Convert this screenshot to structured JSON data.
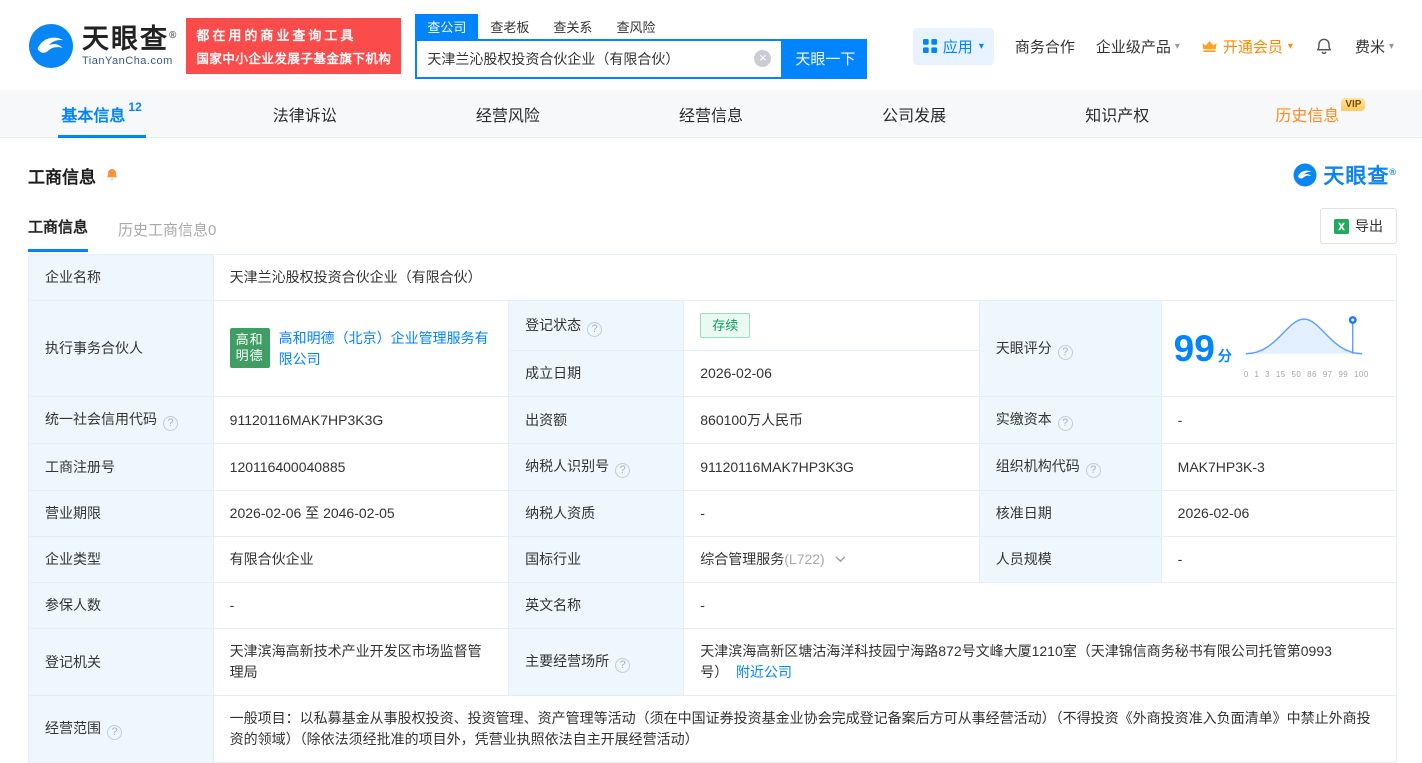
{
  "header": {
    "logo_text": "天眼查",
    "logo_reg": "®",
    "logo_domain": "TianYanCha.com",
    "promo_line1": "都在用的商业查询工具",
    "promo_line2": "国家中小企业发展子基金旗下机构",
    "search_tabs": [
      "查公司",
      "查老板",
      "查关系",
      "查风险"
    ],
    "search_value": "天津兰沁股权投资合伙企业（有限合伙）",
    "search_button": "天眼一下",
    "app_label": "应用",
    "cooperation_label": "商务合作",
    "enterprise_label": "企业级产品",
    "vip_label": "开通会员",
    "user_label": "费米"
  },
  "nav_tabs": [
    {
      "label": "基本信息",
      "count": "12"
    },
    {
      "label": "法律诉讼"
    },
    {
      "label": "经营风险"
    },
    {
      "label": "经营信息"
    },
    {
      "label": "公司发展"
    },
    {
      "label": "知识产权"
    },
    {
      "label": "历史信息",
      "vip": "VIP"
    }
  ],
  "section": {
    "title": "工商信息",
    "brand": "天眼查"
  },
  "subtabs": {
    "current": "工商信息",
    "history": "历史工商信息0",
    "export": "导出"
  },
  "info": {
    "name_label": "企业名称",
    "name": "天津兰沁股权投资合伙企业（有限合伙）",
    "partner_label": "执行事务合伙人",
    "partner_logo": "高和明德",
    "partner_name": "高和明德（北京）企业管理服务有限公司",
    "status_label": "登记状态",
    "status": "存续",
    "score_label": "天眼评分",
    "score_value": "99",
    "score_unit": "分",
    "score_axis": "0 1 3 15 50 86 97 99 100",
    "established_label": "成立日期",
    "established": "2026-02-06",
    "credit_code_label": "统一社会信用代码",
    "credit_code": "91120116MAK7HP3K3G",
    "capital_label": "出资额",
    "capital": "860100万人民币",
    "paid_capital_label": "实缴资本",
    "paid_capital": "-",
    "reg_number_label": "工商注册号",
    "reg_number": "120116400040885",
    "taxpayer_id_label": "纳税人识别号",
    "taxpayer_id": "91120116MAK7HP3K3G",
    "org_code_label": "组织机构代码",
    "org_code": "MAK7HP3K-3",
    "term_label": "营业期限",
    "term": "2026-02-06 至 2046-02-05",
    "taxpayer_quality_label": "纳税人资质",
    "taxpayer_quality": "-",
    "approval_date_label": "核准日期",
    "approval_date": "2026-02-06",
    "company_type_label": "企业类型",
    "company_type": "有限合伙企业",
    "industry_label": "国标行业",
    "industry": "综合管理服务",
    "industry_code": "(L722)",
    "staff_size_label": "人员规模",
    "staff_size": "-",
    "insured_label": "参保人数",
    "insured": "-",
    "english_name_label": "英文名称",
    "english_name": "-",
    "registry_label": "登记机关",
    "registry": "天津滨海高新技术产业开发区市场监督管理局",
    "address_label": "主要经营场所",
    "address": "天津滨海高新区塘沽海洋科技园宁海路872号文峰大厦1210室（天津锦信商务秘书有限公司托管第0993号）",
    "nearby_link": "附近公司",
    "scope_label": "经营范围",
    "scope": "一般项目：以私募基金从事股权投资、投资管理、资产管理等活动（须在中国证券投资基金业协会完成登记备案后方可从事经营活动）（不得投资《外商投资准入负面清单》中禁止外商投资的领域）（除依法须经批准的项目外，凭营业执照依法自主开展经营活动）"
  }
}
